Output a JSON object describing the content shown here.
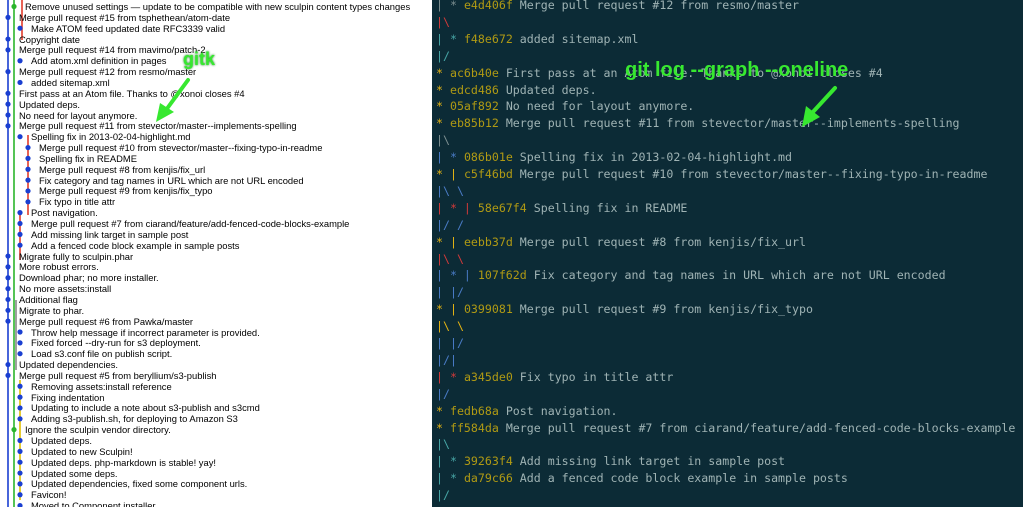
{
  "gitk": {
    "label": "gitk",
    "commits": [
      {
        "msg": "Remove unused settings — update to be compatible with new sculpin content types changes",
        "col": 1
      },
      {
        "msg": "Merge pull request #15 from tsphethean/atom-date",
        "col": 0
      },
      {
        "msg": "Make ATOM feed updated date RFC3339 valid",
        "col": 2
      },
      {
        "msg": "Copyright date",
        "col": 0
      },
      {
        "msg": "Merge pull request #14 from mavimo/patch-2",
        "col": 0
      },
      {
        "msg": "Add atom.xml definition in pages",
        "col": 2
      },
      {
        "msg": "Merge pull request #12 from resmo/master",
        "col": 0
      },
      {
        "msg": "added sitemap.xml",
        "col": 2
      },
      {
        "msg": "First pass at an Atom file. Thanks to @xonoi closes #4",
        "col": 0
      },
      {
        "msg": "Updated deps.",
        "col": 0
      },
      {
        "msg": "No need for layout anymore.",
        "col": 0
      },
      {
        "msg": "Merge pull request #11 from stevector/master--implements-spelling",
        "col": 0
      },
      {
        "msg": "Spelling fix in 2013-02-04-highlight.md",
        "col": 2
      },
      {
        "msg": "Merge pull request #10 from stevector/master--fixing-typo-in-readme",
        "col": 3
      },
      {
        "msg": "Spelling fix in README",
        "col": 3
      },
      {
        "msg": "Merge pull request #8 from kenjis/fix_url",
        "col": 3
      },
      {
        "msg": "Fix category and tag names in URL which are not URL encoded",
        "col": 3
      },
      {
        "msg": "Merge pull request #9 from kenjis/fix_typo",
        "col": 3
      },
      {
        "msg": "Fix typo in title attr",
        "col": 3
      },
      {
        "msg": "Post navigation.",
        "col": 2
      },
      {
        "msg": "Merge pull request #7 from ciarand/feature/add-fenced-code-blocks-example",
        "col": 2
      },
      {
        "msg": "Add missing link target in sample post",
        "col": 2
      },
      {
        "msg": "Add a fenced code block example in sample posts",
        "col": 2
      },
      {
        "msg": "Migrate fully to sculpin.phar",
        "col": 0
      },
      {
        "msg": "More robust errors.",
        "col": 0
      },
      {
        "msg": "Download phar; no more installer.",
        "col": 0
      },
      {
        "msg": "No more assets:install",
        "col": 0
      },
      {
        "msg": "Additional flag",
        "col": 0
      },
      {
        "msg": "Migrate to phar.",
        "col": 0
      },
      {
        "msg": "Merge pull request #6 from Pawka/master",
        "col": 0
      },
      {
        "msg": "Throw help message if incorrect parameter is provided.",
        "col": 2
      },
      {
        "msg": "Fixed forced --dry-run for s3 deployment.",
        "col": 2
      },
      {
        "msg": "Load s3.conf file on publish script.",
        "col": 2
      },
      {
        "msg": "Updated dependencies.",
        "col": 0
      },
      {
        "msg": "Merge pull request #5 from beryllium/s3-publish",
        "col": 0
      },
      {
        "msg": "Removing assets:install reference",
        "col": 2
      },
      {
        "msg": "Fixing indentation",
        "col": 2
      },
      {
        "msg": "Updating to include a note about s3-publish and s3cmd",
        "col": 2
      },
      {
        "msg": "Adding s3-publish.sh, for deploying to Amazon S3",
        "col": 2
      },
      {
        "msg": "Ignore the sculpin vendor directory.",
        "col": 1
      },
      {
        "msg": "Updated deps.",
        "col": 2
      },
      {
        "msg": "Updated to new Sculpin!",
        "col": 2
      },
      {
        "msg": "Updated deps. php-markdown is stable! yay!",
        "col": 2
      },
      {
        "msg": "Updated some deps.",
        "col": 2
      },
      {
        "msg": "Updated dependencies, fixed some component urls.",
        "col": 2
      },
      {
        "msg": "Favicon!",
        "col": 2
      },
      {
        "msg": "Moved to Component installer",
        "col": 2
      }
    ]
  },
  "terminal": {
    "label": "git log --graph --oneline",
    "lines": [
      {
        "graph": "|",
        "star": "*",
        "hash": "e4d406f",
        "msg": "Merge pull request #12 from resmo/master",
        "gcolor": "g",
        "indent": 2
      },
      {
        "graph": "|\\",
        "star": "",
        "hash": "",
        "msg": "",
        "gcolor": "gr",
        "indent": 0
      },
      {
        "graph": "| *",
        "star": "",
        "hash": "f48e672",
        "msg": "added sitemap.xml",
        "gcolor": "gc",
        "indent": 0
      },
      {
        "graph": "|/",
        "star": "",
        "hash": "",
        "msg": "",
        "gcolor": "gc",
        "indent": 0
      },
      {
        "graph": "*",
        "star": "",
        "hash": "ac6b40e",
        "msg": "First pass at an Atom file. Thanks to @xonoi closes #4",
        "gcolor": "gy",
        "indent": 0
      },
      {
        "graph": "*",
        "star": "",
        "hash": "edcd486",
        "msg": "Updated deps.",
        "gcolor": "gy",
        "indent": 0
      },
      {
        "graph": "*",
        "star": "",
        "hash": "05af892",
        "msg": "No need for layout anymore.",
        "gcolor": "gy",
        "indent": 0
      },
      {
        "graph": "*",
        "star": "",
        "hash": "eb85b12",
        "msg": "Merge pull request #11 from stevector/master--implements-spelling",
        "gcolor": "gy",
        "indent": 2
      },
      {
        "graph": "|\\",
        "star": "",
        "hash": "",
        "msg": "",
        "gcolor": "g",
        "indent": 0
      },
      {
        "graph": "| *",
        "star": "",
        "hash": "086b01e",
        "msg": "Spelling fix in 2013-02-04-highlight.md",
        "gcolor": "gb",
        "indent": 0
      },
      {
        "graph": "* |",
        "star": "",
        "hash": "c5f46bd",
        "msg": "Merge pull request #10 from stevector/master--fixing-typo-in-readme",
        "gcolor": "gy",
        "indent": 2
      },
      {
        "graph": "|\\ \\",
        "star": "",
        "hash": "",
        "msg": "",
        "gcolor": "gb",
        "indent": 0
      },
      {
        "graph": "| * |",
        "star": "",
        "hash": "58e67f4",
        "msg": "Spelling fix in README",
        "gcolor": "gr",
        "indent": 0
      },
      {
        "graph": "|/ /",
        "star": "",
        "hash": "",
        "msg": "",
        "gcolor": "gb",
        "indent": 0
      },
      {
        "graph": "* |",
        "star": "",
        "hash": "eebb37d",
        "msg": "Merge pull request #8 from kenjis/fix_url",
        "gcolor": "gy",
        "indent": 2
      },
      {
        "graph": "|\\ \\",
        "star": "",
        "hash": "",
        "msg": "",
        "gcolor": "gr",
        "indent": 0
      },
      {
        "graph": "| * |",
        "star": "",
        "hash": "107f62d",
        "msg": "Fix category and tag names in URL which are not URL encoded",
        "gcolor": "gb",
        "indent": 0
      },
      {
        "graph": "| |/",
        "star": "",
        "hash": "",
        "msg": "",
        "gcolor": "gb",
        "indent": 0
      },
      {
        "graph": "* |",
        "star": "",
        "hash": "0399081",
        "msg": "Merge pull request #9 from kenjis/fix_typo",
        "gcolor": "gy",
        "indent": 2
      },
      {
        "graph": "|\\ \\",
        "star": "",
        "hash": "",
        "msg": "",
        "gcolor": "gy",
        "indent": 0
      },
      {
        "graph": "| |/",
        "star": "",
        "hash": "",
        "msg": "",
        "gcolor": "gb",
        "indent": 0
      },
      {
        "graph": "|/|",
        "star": "",
        "hash": "",
        "msg": "",
        "gcolor": "gb",
        "indent": 0
      },
      {
        "graph": "| *",
        "star": "",
        "hash": "a345de0",
        "msg": "Fix typo in title attr",
        "gcolor": "gr",
        "indent": 0
      },
      {
        "graph": "|/",
        "star": "",
        "hash": "",
        "msg": "",
        "gcolor": "gb",
        "indent": 0
      },
      {
        "graph": "*",
        "star": "",
        "hash": "fedb68a",
        "msg": "Post navigation.",
        "gcolor": "gy",
        "indent": 0
      },
      {
        "graph": "*",
        "star": "",
        "hash": "ff584da",
        "msg": "Merge pull request #7 from ciarand/feature/add-fenced-code-blocks-example",
        "gcolor": "gy",
        "indent": 2
      },
      {
        "graph": "|\\",
        "star": "",
        "hash": "",
        "msg": "",
        "gcolor": "gc",
        "indent": 0
      },
      {
        "graph": "| *",
        "star": "",
        "hash": "39263f4",
        "msg": "Add missing link target in sample post",
        "gcolor": "gc",
        "indent": 0
      },
      {
        "graph": "| *",
        "star": "",
        "hash": "da79c66",
        "msg": "Add a fenced code block example in sample posts",
        "gcolor": "gc",
        "indent": 0
      },
      {
        "graph": "|/",
        "star": "",
        "hash": "",
        "msg": "",
        "gcolor": "gc",
        "indent": 0
      }
    ]
  },
  "colors": {
    "terminal_bg": "#0c2b36",
    "hash": "#b09a14",
    "annotation": "#37e830"
  }
}
